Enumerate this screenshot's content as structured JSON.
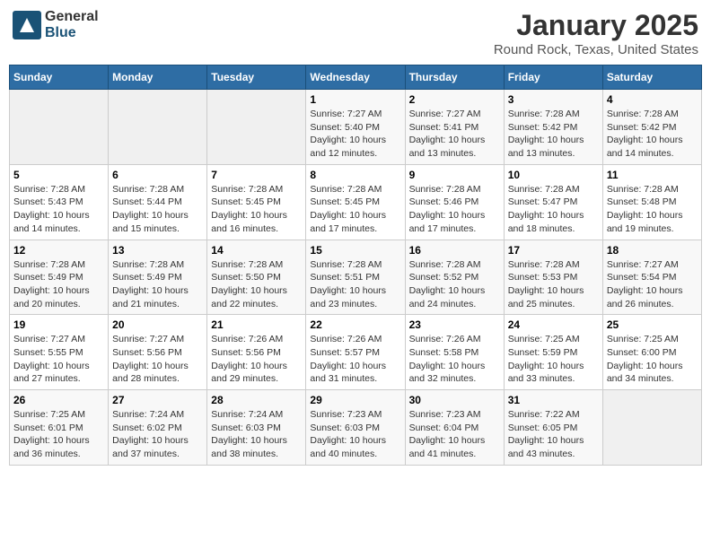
{
  "header": {
    "logo_general": "General",
    "logo_blue": "Blue",
    "title": "January 2025",
    "subtitle": "Round Rock, Texas, United States"
  },
  "days_of_week": [
    "Sunday",
    "Monday",
    "Tuesday",
    "Wednesday",
    "Thursday",
    "Friday",
    "Saturday"
  ],
  "weeks": [
    {
      "cells": [
        {
          "day": null,
          "info": null
        },
        {
          "day": null,
          "info": null
        },
        {
          "day": null,
          "info": null
        },
        {
          "day": "1",
          "info": "Sunrise: 7:27 AM\nSunset: 5:40 PM\nDaylight: 10 hours\nand 12 minutes."
        },
        {
          "day": "2",
          "info": "Sunrise: 7:27 AM\nSunset: 5:41 PM\nDaylight: 10 hours\nand 13 minutes."
        },
        {
          "day": "3",
          "info": "Sunrise: 7:28 AM\nSunset: 5:42 PM\nDaylight: 10 hours\nand 13 minutes."
        },
        {
          "day": "4",
          "info": "Sunrise: 7:28 AM\nSunset: 5:42 PM\nDaylight: 10 hours\nand 14 minutes."
        }
      ]
    },
    {
      "cells": [
        {
          "day": "5",
          "info": "Sunrise: 7:28 AM\nSunset: 5:43 PM\nDaylight: 10 hours\nand 14 minutes."
        },
        {
          "day": "6",
          "info": "Sunrise: 7:28 AM\nSunset: 5:44 PM\nDaylight: 10 hours\nand 15 minutes."
        },
        {
          "day": "7",
          "info": "Sunrise: 7:28 AM\nSunset: 5:45 PM\nDaylight: 10 hours\nand 16 minutes."
        },
        {
          "day": "8",
          "info": "Sunrise: 7:28 AM\nSunset: 5:45 PM\nDaylight: 10 hours\nand 17 minutes."
        },
        {
          "day": "9",
          "info": "Sunrise: 7:28 AM\nSunset: 5:46 PM\nDaylight: 10 hours\nand 17 minutes."
        },
        {
          "day": "10",
          "info": "Sunrise: 7:28 AM\nSunset: 5:47 PM\nDaylight: 10 hours\nand 18 minutes."
        },
        {
          "day": "11",
          "info": "Sunrise: 7:28 AM\nSunset: 5:48 PM\nDaylight: 10 hours\nand 19 minutes."
        }
      ]
    },
    {
      "cells": [
        {
          "day": "12",
          "info": "Sunrise: 7:28 AM\nSunset: 5:49 PM\nDaylight: 10 hours\nand 20 minutes."
        },
        {
          "day": "13",
          "info": "Sunrise: 7:28 AM\nSunset: 5:49 PM\nDaylight: 10 hours\nand 21 minutes."
        },
        {
          "day": "14",
          "info": "Sunrise: 7:28 AM\nSunset: 5:50 PM\nDaylight: 10 hours\nand 22 minutes."
        },
        {
          "day": "15",
          "info": "Sunrise: 7:28 AM\nSunset: 5:51 PM\nDaylight: 10 hours\nand 23 minutes."
        },
        {
          "day": "16",
          "info": "Sunrise: 7:28 AM\nSunset: 5:52 PM\nDaylight: 10 hours\nand 24 minutes."
        },
        {
          "day": "17",
          "info": "Sunrise: 7:28 AM\nSunset: 5:53 PM\nDaylight: 10 hours\nand 25 minutes."
        },
        {
          "day": "18",
          "info": "Sunrise: 7:27 AM\nSunset: 5:54 PM\nDaylight: 10 hours\nand 26 minutes."
        }
      ]
    },
    {
      "cells": [
        {
          "day": "19",
          "info": "Sunrise: 7:27 AM\nSunset: 5:55 PM\nDaylight: 10 hours\nand 27 minutes."
        },
        {
          "day": "20",
          "info": "Sunrise: 7:27 AM\nSunset: 5:56 PM\nDaylight: 10 hours\nand 28 minutes."
        },
        {
          "day": "21",
          "info": "Sunrise: 7:26 AM\nSunset: 5:56 PM\nDaylight: 10 hours\nand 29 minutes."
        },
        {
          "day": "22",
          "info": "Sunrise: 7:26 AM\nSunset: 5:57 PM\nDaylight: 10 hours\nand 31 minutes."
        },
        {
          "day": "23",
          "info": "Sunrise: 7:26 AM\nSunset: 5:58 PM\nDaylight: 10 hours\nand 32 minutes."
        },
        {
          "day": "24",
          "info": "Sunrise: 7:25 AM\nSunset: 5:59 PM\nDaylight: 10 hours\nand 33 minutes."
        },
        {
          "day": "25",
          "info": "Sunrise: 7:25 AM\nSunset: 6:00 PM\nDaylight: 10 hours\nand 34 minutes."
        }
      ]
    },
    {
      "cells": [
        {
          "day": "26",
          "info": "Sunrise: 7:25 AM\nSunset: 6:01 PM\nDaylight: 10 hours\nand 36 minutes."
        },
        {
          "day": "27",
          "info": "Sunrise: 7:24 AM\nSunset: 6:02 PM\nDaylight: 10 hours\nand 37 minutes."
        },
        {
          "day": "28",
          "info": "Sunrise: 7:24 AM\nSunset: 6:03 PM\nDaylight: 10 hours\nand 38 minutes."
        },
        {
          "day": "29",
          "info": "Sunrise: 7:23 AM\nSunset: 6:03 PM\nDaylight: 10 hours\nand 40 minutes."
        },
        {
          "day": "30",
          "info": "Sunrise: 7:23 AM\nSunset: 6:04 PM\nDaylight: 10 hours\nand 41 minutes."
        },
        {
          "day": "31",
          "info": "Sunrise: 7:22 AM\nSunset: 6:05 PM\nDaylight: 10 hours\nand 43 minutes."
        },
        {
          "day": null,
          "info": null
        }
      ]
    }
  ]
}
